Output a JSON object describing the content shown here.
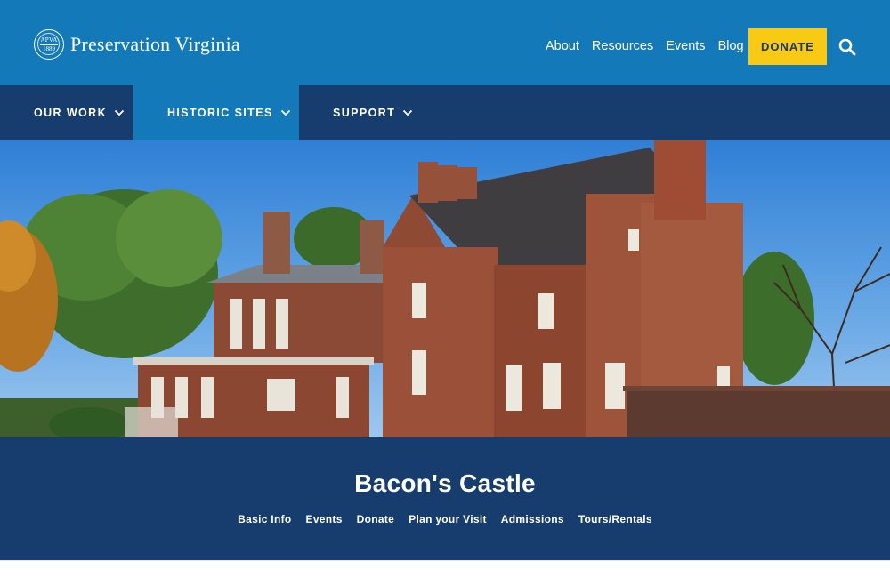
{
  "header": {
    "logo": {
      "seal_top": "APVA",
      "seal_bottom": "1889",
      "name": "Preservation Virginia"
    },
    "utility_links": [
      "About",
      "Resources",
      "Events",
      "Blog"
    ],
    "donate_label": "DONATE",
    "search_icon": "search-icon",
    "colors": {
      "brand_blue": "#1479b8",
      "navy": "#163d6e",
      "donate_yellow": "#f8c915"
    }
  },
  "main_nav": {
    "items": [
      {
        "label": "OUR WORK",
        "icon": "chevron-down-icon",
        "active": false
      },
      {
        "label": "HISTORIC SITES",
        "icon": "chevron-down-icon",
        "active": true
      },
      {
        "label": "SUPPORT",
        "icon": "chevron-down-icon",
        "active": false
      }
    ]
  },
  "page": {
    "title": "Bacon's Castle",
    "subnav": [
      "Basic Info",
      "Events",
      "Donate",
      "Plan your Visit",
      "Admissions",
      "Tours/Rentals"
    ]
  }
}
